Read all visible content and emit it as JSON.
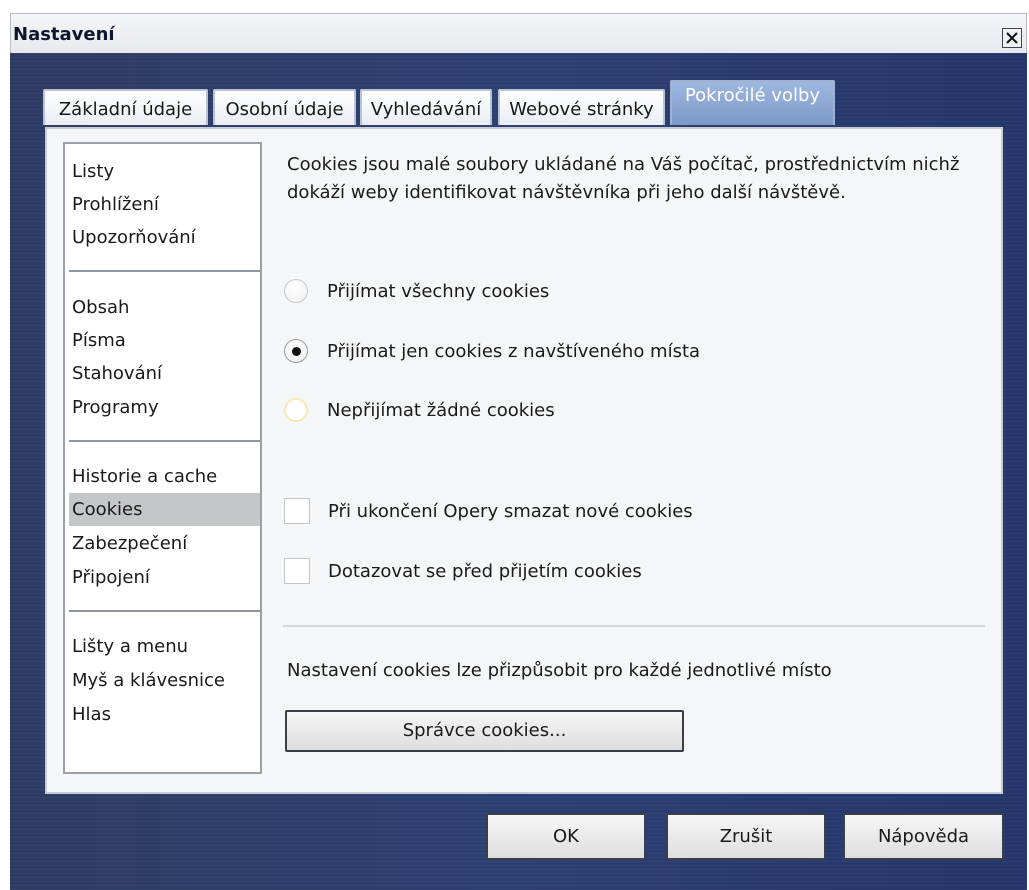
{
  "window": {
    "title": "Nastavení",
    "close_icon": "close-icon"
  },
  "tabs": [
    {
      "label": "Základní údaje",
      "active": false
    },
    {
      "label": "Osobní údaje",
      "active": false
    },
    {
      "label": "Vyhledávání",
      "active": false
    },
    {
      "label": "Webové stránky",
      "active": false
    },
    {
      "label": "Pokročilé volby",
      "active": true
    }
  ],
  "sidebar": {
    "groups": [
      [
        "Listy",
        "Prohlížení",
        "Upozorňování"
      ],
      [
        "Obsah",
        "Písma",
        "Stahování",
        "Programy"
      ],
      [
        "Historie a cache",
        "Cookies",
        "Zabezpečení",
        "Připojení"
      ],
      [
        "Lišty a menu",
        "Myš a klávesnice",
        "Hlas"
      ]
    ],
    "selected": "Cookies"
  },
  "cookies": {
    "intro": "Cookies jsou malé soubory ukládané na Váš počítač, prostřednictvím nichž dokáží weby identifikovat návštěvníka při jeho další návštěvě.",
    "radios": [
      {
        "label": "Přijímat všechny cookies",
        "checked": false
      },
      {
        "label": "Přijímat jen cookies z navštíveného místa",
        "checked": true
      },
      {
        "label": "Nepřijímat žádné cookies",
        "checked": false
      }
    ],
    "checkboxes": [
      {
        "label": "Při ukončení Opery smazat nové cookies",
        "checked": false
      },
      {
        "label": "Dotazovat se před přijetím cookies",
        "checked": false
      }
    ],
    "hint": "Nastavení cookies lze přizpůsobit pro každé jednotlivé místo",
    "manager_button": "Správce cookies..."
  },
  "footer": {
    "ok": "OK",
    "cancel": "Zrušit",
    "help": "Nápověda"
  }
}
